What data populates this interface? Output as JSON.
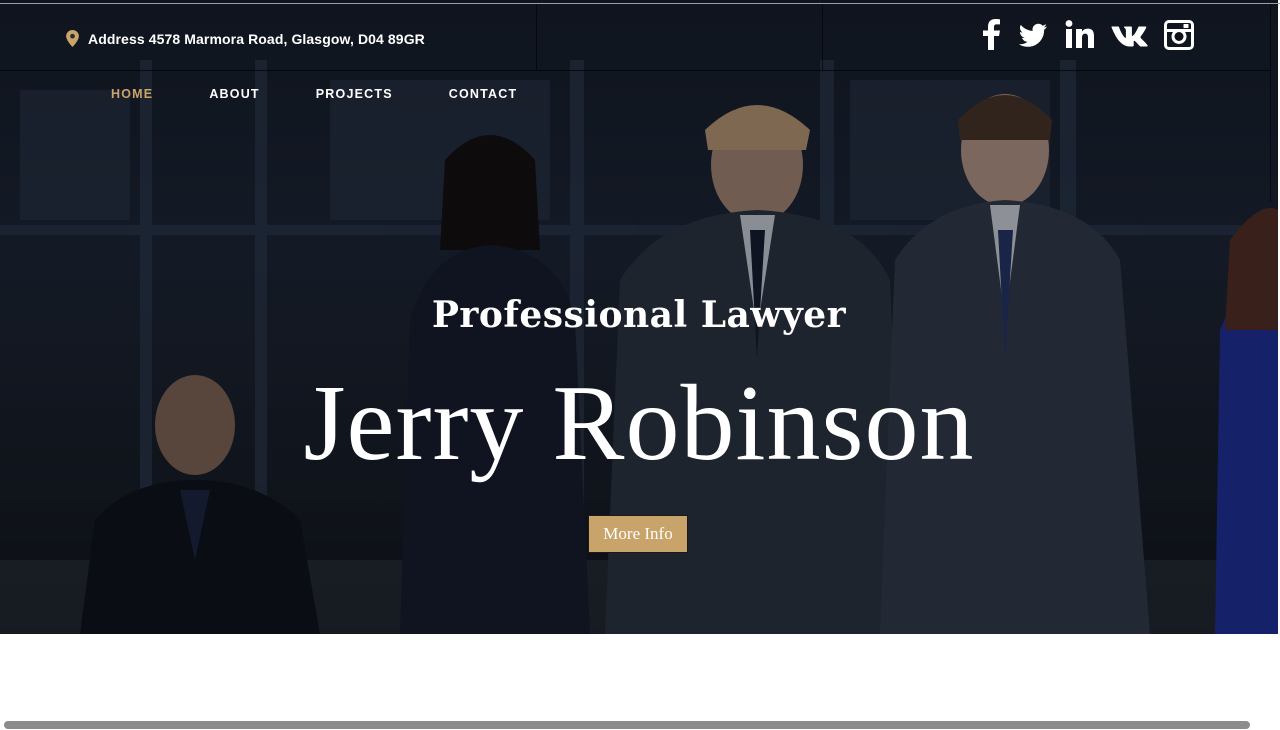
{
  "header": {
    "address": "Address 4578 Marmora Road, Glasgow, D04 89GR",
    "social": [
      {
        "icon": "facebook-icon"
      },
      {
        "icon": "twitter-icon"
      },
      {
        "icon": "linkedin-icon"
      },
      {
        "icon": "vk-icon"
      },
      {
        "icon": "instagram-icon"
      }
    ]
  },
  "nav": {
    "items": [
      {
        "label": "HOME",
        "active": true
      },
      {
        "label": "ABOUT",
        "active": false
      },
      {
        "label": "PROJECTS",
        "active": false
      },
      {
        "label": "CONTACT",
        "active": false
      }
    ]
  },
  "hero": {
    "subtitle": "Professional Lawyer",
    "title": "Jerry Robinson",
    "button_label": "More Info"
  },
  "colors": {
    "accent": "#c9a46a",
    "text": "#ffffff",
    "overlay": "#0d1119"
  }
}
